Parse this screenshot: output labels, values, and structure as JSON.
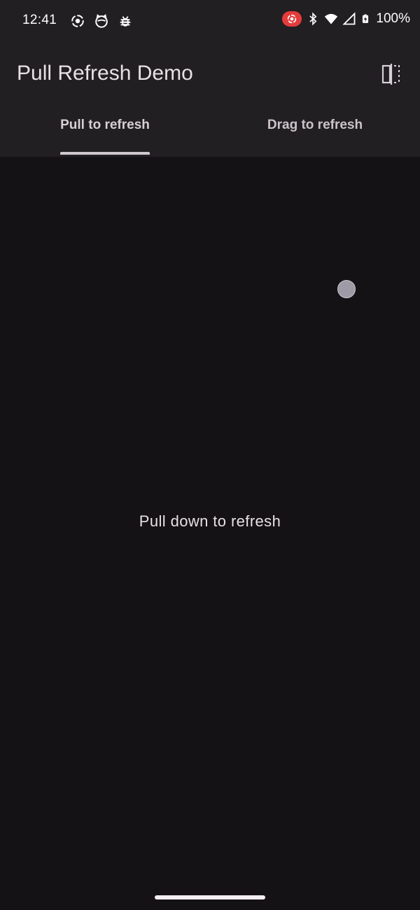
{
  "status_bar": {
    "time": "12:41",
    "left_icons": [
      "screen-record-icon",
      "cat-face-icon",
      "bug-icon"
    ],
    "right_icons": [
      "screen-record-pill-icon",
      "bluetooth-icon",
      "wifi-icon",
      "signal-icon",
      "battery-charging-icon"
    ],
    "battery": "100%",
    "record_color": "#e43c3c"
  },
  "app_bar": {
    "title": "Pull Refresh Demo",
    "action_icon": "fold-screen-icon"
  },
  "tabs": [
    {
      "label": "Pull to refresh",
      "selected": true
    },
    {
      "label": "Drag to refresh",
      "selected": false
    }
  ],
  "content": {
    "message": "Pull down to refresh"
  },
  "colors": {
    "background": "#151215",
    "app_bar": "#221f22",
    "text": "#e6e1e5",
    "indicator": "#9f9ba6"
  }
}
